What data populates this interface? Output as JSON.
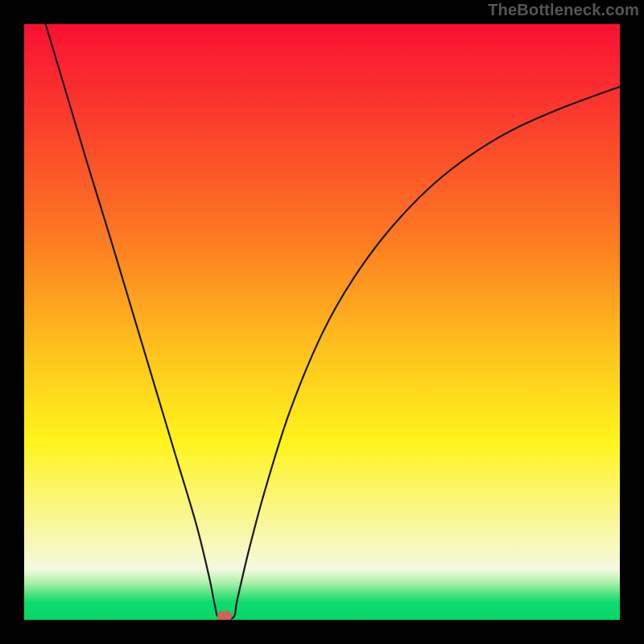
{
  "watermark": "TheBottleneck.com",
  "colors": {
    "frame": "#000000",
    "curve_stroke": "#1a1a1a",
    "dot_fill": "#d06256",
    "gradient_stops": [
      {
        "offset": 0.0,
        "color": "#f91033"
      },
      {
        "offset": 0.15,
        "color": "#fb3a2d"
      },
      {
        "offset": 0.35,
        "color": "#fd7722"
      },
      {
        "offset": 0.55,
        "color": "#fec31d"
      },
      {
        "offset": 0.7,
        "color": "#fff41c"
      },
      {
        "offset": 0.82,
        "color": "#faf78b"
      },
      {
        "offset": 0.89,
        "color": "#f7f8c8"
      },
      {
        "offset": 0.915,
        "color": "#f3f9e1"
      },
      {
        "offset": 0.935,
        "color": "#b8f1b1"
      },
      {
        "offset": 0.955,
        "color": "#56e483"
      },
      {
        "offset": 0.97,
        "color": "#10da6f"
      },
      {
        "offset": 1.0,
        "color": "#03d768"
      }
    ]
  },
  "chart_data": {
    "type": "line",
    "title": "",
    "xlabel": "",
    "ylabel": "",
    "xlim": [
      0,
      1
    ],
    "ylim": [
      0,
      1
    ],
    "note": "y is normalised bottleneck severity (0 at bottom, 1 at top). Curve is V-shaped with a sharp minimum near x≈0.33 touching y≈0; left branch steeper than right.",
    "series": [
      {
        "name": "bottleneck-curve",
        "points": [
          {
            "x": 0.036,
            "y": 1.0
          },
          {
            "x": 0.072,
            "y": 0.88
          },
          {
            "x": 0.108,
            "y": 0.76
          },
          {
            "x": 0.145,
            "y": 0.64
          },
          {
            "x": 0.181,
            "y": 0.52
          },
          {
            "x": 0.217,
            "y": 0.4
          },
          {
            "x": 0.253,
            "y": 0.28
          },
          {
            "x": 0.289,
            "y": 0.16
          },
          {
            "x": 0.311,
            "y": 0.07
          },
          {
            "x": 0.32,
            "y": 0.025
          },
          {
            "x": 0.327,
            "y": 0.004
          },
          {
            "x": 0.351,
            "y": 0.004
          },
          {
            "x": 0.358,
            "y": 0.035
          },
          {
            "x": 0.378,
            "y": 0.12
          },
          {
            "x": 0.405,
            "y": 0.22
          },
          {
            "x": 0.446,
            "y": 0.35
          },
          {
            "x": 0.5,
            "y": 0.48
          },
          {
            "x": 0.554,
            "y": 0.575
          },
          {
            "x": 0.622,
            "y": 0.665
          },
          {
            "x": 0.703,
            "y": 0.745
          },
          {
            "x": 0.797,
            "y": 0.81
          },
          {
            "x": 0.892,
            "y": 0.855
          },
          {
            "x": 1.0,
            "y": 0.895
          }
        ]
      }
    ],
    "marker": {
      "x_norm": 0.336,
      "y_norm": 0.006
    }
  }
}
